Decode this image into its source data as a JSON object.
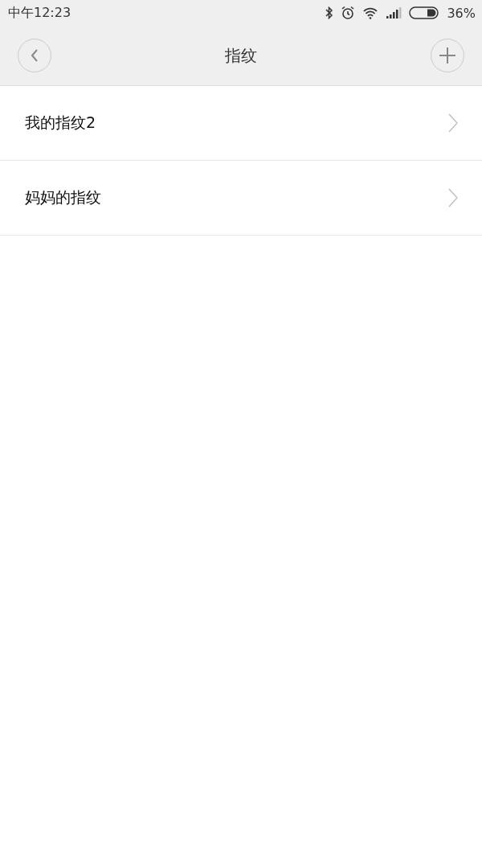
{
  "status_bar": {
    "time": "中午12:23",
    "battery": "36%"
  },
  "header": {
    "title": "指纹"
  },
  "items": [
    {
      "label": "我的指纹2"
    },
    {
      "label": "妈妈的指纹"
    }
  ]
}
